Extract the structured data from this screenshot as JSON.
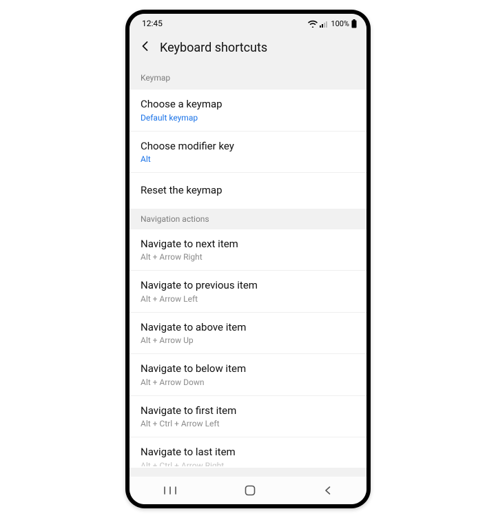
{
  "status": {
    "time": "12:45",
    "battery": "100%"
  },
  "header": {
    "title": "Keyboard shortcuts"
  },
  "sections": {
    "keymap": {
      "header": "Keymap",
      "choose_keymap": {
        "title": "Choose a keymap",
        "sub": "Default keymap"
      },
      "choose_modifier": {
        "title": "Choose modifier key",
        "sub": "Alt"
      },
      "reset": {
        "title": "Reset the keymap"
      }
    },
    "nav": {
      "header": "Navigation actions",
      "next": {
        "title": "Navigate to next item",
        "sub": "Alt + Arrow Right"
      },
      "prev": {
        "title": "Navigate to previous item",
        "sub": "Alt + Arrow Left"
      },
      "above": {
        "title": "Navigate to above item",
        "sub": "Alt + Arrow Up"
      },
      "below": {
        "title": "Navigate to below item",
        "sub": "Alt + Arrow Down"
      },
      "first": {
        "title": "Navigate to first item",
        "sub": "Alt + Ctrl + Arrow Left"
      },
      "last": {
        "title": "Navigate to last item",
        "sub": "Alt + Ctrl + Arrow Right"
      }
    }
  }
}
